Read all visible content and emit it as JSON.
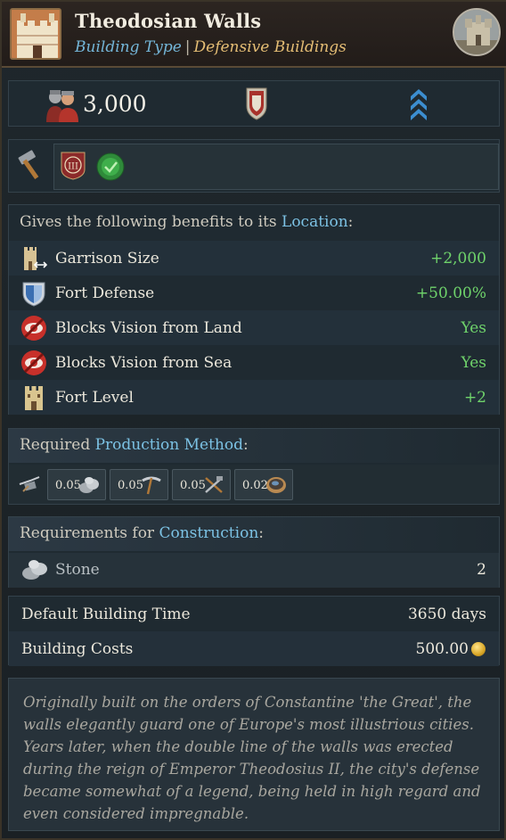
{
  "header": {
    "title": "Theodosian Walls",
    "type_label": "Building Type",
    "separator": "|",
    "category": "Defensive Buildings"
  },
  "stats": {
    "manpower": "3,000"
  },
  "benefits": {
    "intro_prefix": "Gives the following benefits to its ",
    "intro_link": "Location",
    "intro_suffix": ":",
    "rows": [
      {
        "icon": "garrison-icon",
        "label": "Garrison Size",
        "value": "+2,000"
      },
      {
        "icon": "fort-defense-icon",
        "label": "Fort Defense",
        "value": "+50.00%"
      },
      {
        "icon": "blocks-vision-icon",
        "label": "Blocks Vision from Land",
        "value": "Yes"
      },
      {
        "icon": "blocks-vision-icon",
        "label": "Blocks Vision from Sea",
        "value": "Yes"
      },
      {
        "icon": "fort-level-icon",
        "label": "Fort Level",
        "value": "+2"
      }
    ]
  },
  "production": {
    "heading_prefix": "Required ",
    "heading_link": "Production Method",
    "heading_suffix": ":",
    "items": [
      {
        "amount": "0.05",
        "icon": "stone-icon"
      },
      {
        "amount": "0.05",
        "icon": "pickaxe-icon"
      },
      {
        "amount": "0.05",
        "icon": "tools-icon"
      },
      {
        "amount": "0.02",
        "icon": "bowl-icon"
      }
    ]
  },
  "requirements": {
    "heading_prefix": "Requirements for ",
    "heading_link": "Construction",
    "heading_suffix": ":",
    "item_label": "Stone",
    "item_value": "2"
  },
  "costs": {
    "time_label": "Default Building Time",
    "time_value": "3650 days",
    "cost_label": "Building Costs",
    "cost_value": "500.00"
  },
  "flavor": "Originally built on the orders of Constantine 'the Great', the walls elegantly guard one of Europe's most illustrious cities. Years later, when the double line of the walls was erected during the reign of Emperor Theodosius II, the city's defense became somewhat of a legend, being held in high regard and even considered impregnable.",
  "colors": {
    "positive": "#6fd36b",
    "link": "#7cc2e4",
    "category": "#e4bd74"
  }
}
